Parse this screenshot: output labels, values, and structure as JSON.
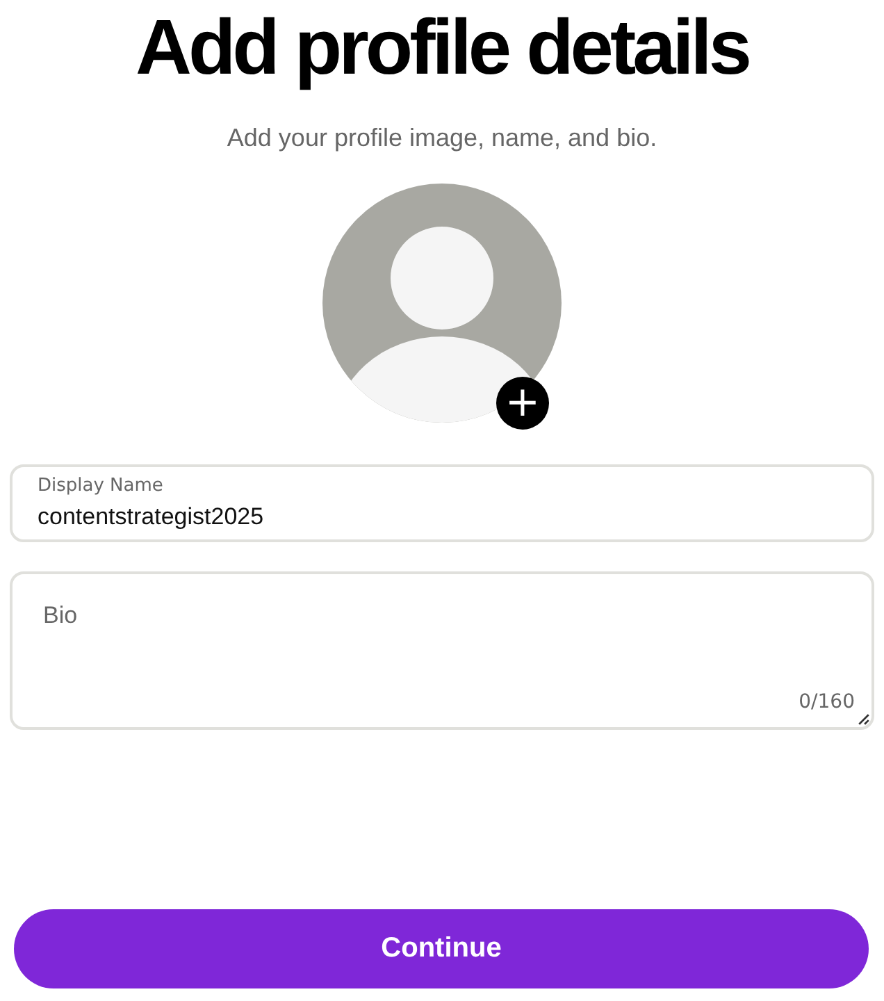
{
  "title": "Add profile details",
  "subtitle": "Add your profile image, name, and bio.",
  "avatar": {
    "add_button": "+"
  },
  "fields": [
    {
      "kind": "input",
      "label": "Display Name",
      "value": "contentstrategist2025"
    },
    {
      "kind": "textarea",
      "placeholder": "Bio",
      "counter": "0/160"
    }
  ],
  "primary_button": "Continue"
}
